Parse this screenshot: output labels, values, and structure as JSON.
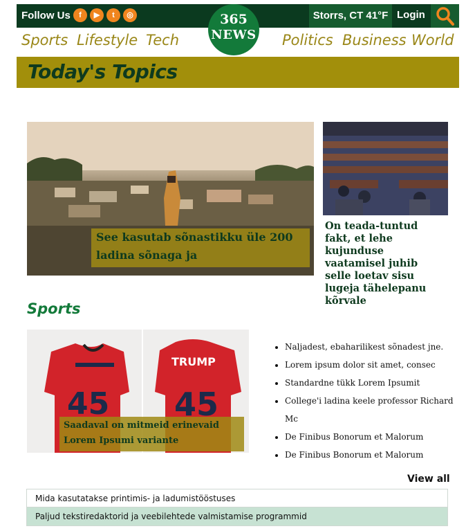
{
  "header": {
    "follow_label": "Follow Us",
    "social_icons": [
      "facebook-icon",
      "youtube-icon",
      "twitter-icon",
      "instagram-icon"
    ],
    "weather": "Storrs, CT 41°F",
    "login": "Login",
    "logo_line1": "365",
    "logo_line2": "NEWS"
  },
  "nav": {
    "left": [
      "Sports",
      "Lifestyle",
      "Tech"
    ],
    "right": [
      "Politics",
      "Business",
      "World"
    ]
  },
  "banner_title": "Today's Topics",
  "hero": {
    "caption": "See kasutab sõnastikku üle 200 ladina sõnaga ja"
  },
  "side_story": {
    "title": "On teada-tuntud fakt, et lehe kujunduse vaatamisel juhib selle loetav sisu lugeja tähelepanu kõrvale"
  },
  "sports": {
    "heading": "Sports",
    "shirt_text": "TRUMP",
    "shirt_number": "45",
    "image_caption": "Saadaval on mitmeid erinevaid Lorem Ipsumi variante",
    "bullets": [
      "Naljadest, ebaharilikest sõnadest jne.",
      "Lorem ipsum dolor sit amet, consec",
      "Standardne tükk Lorem Ipsumit",
      "College'i ladina keele professor Richard Mc",
      "De Finibus Bonorum et Malorum",
      "De Finibus Bonorum et Malorum"
    ],
    "view_all": "View all"
  },
  "list_rows": [
    "Mida kasutatakse printimis- ja ladumistööstuses",
    "Paljud tekstiredaktorid ja veebilehtede valmistamise programmid"
  ],
  "colors": {
    "dark_green": "#0b3a1f",
    "accent_green": "#137a3a",
    "olive": "#a28f0b",
    "orange": "#f0851e",
    "row_alt": "#c7e2d3"
  }
}
